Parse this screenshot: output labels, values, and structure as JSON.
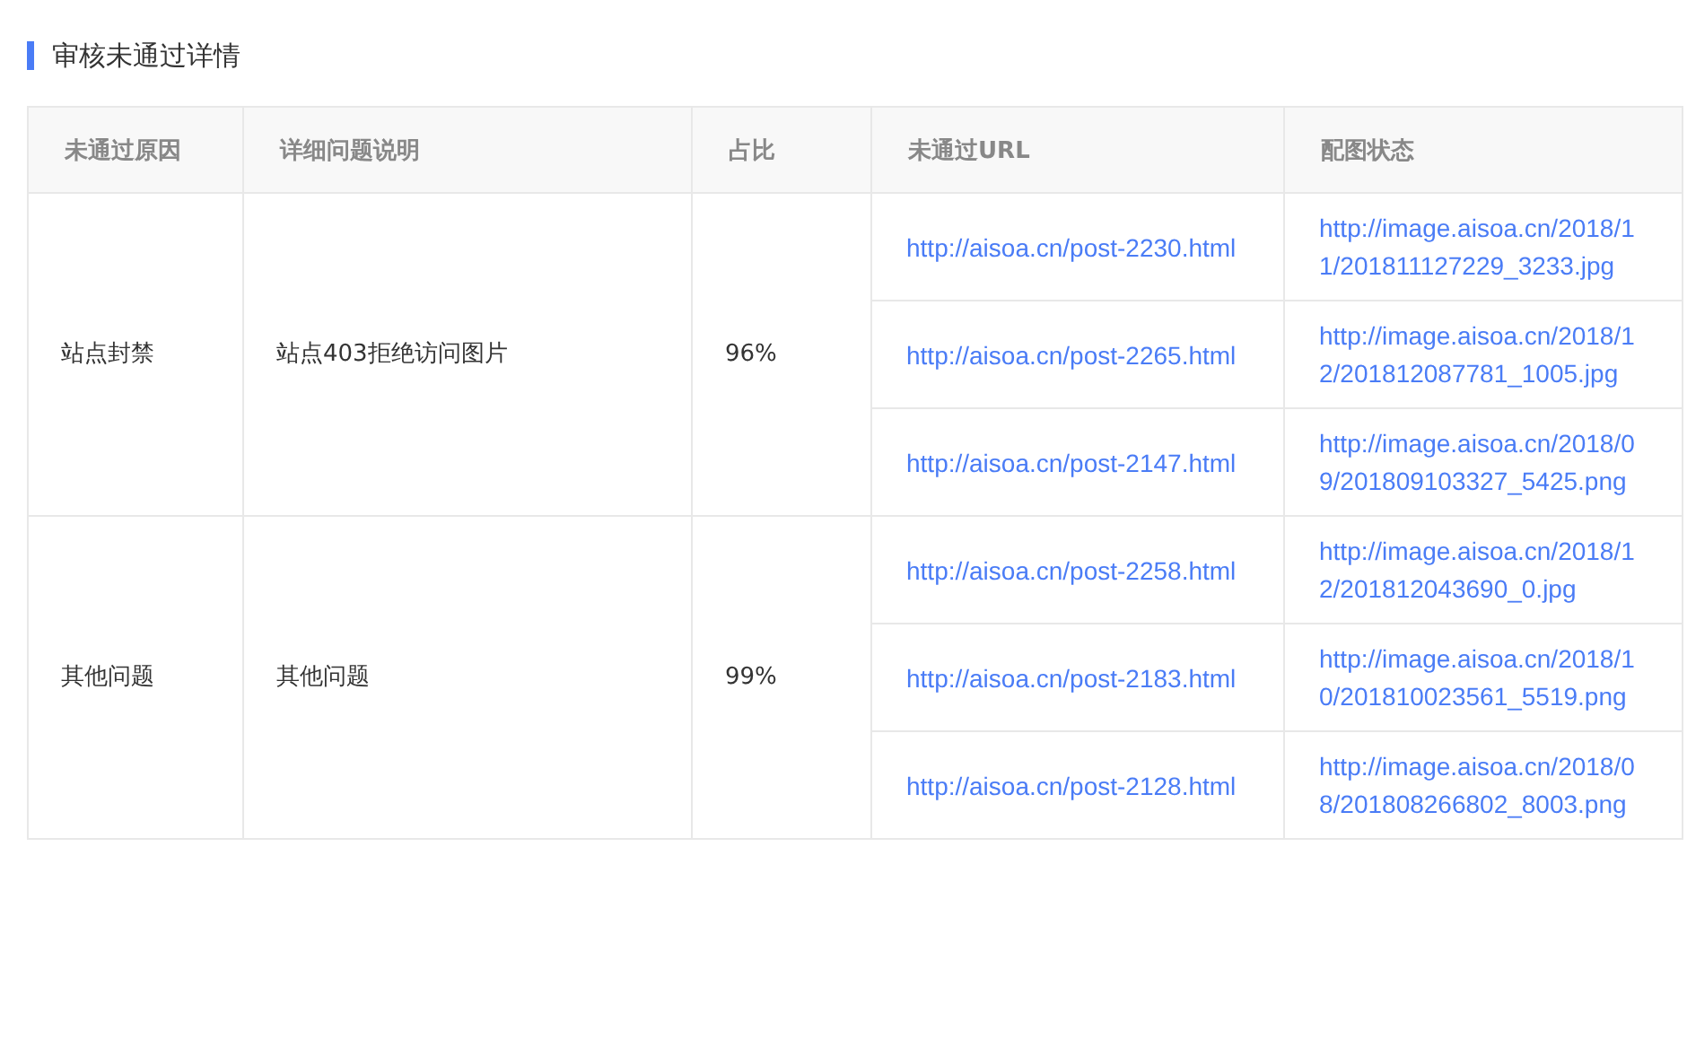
{
  "section_title": "审核未通过详情",
  "table": {
    "columns": [
      "未通过原因",
      "详细问题说明",
      "占比",
      "未通过URL",
      "配图状态"
    ],
    "groups": [
      {
        "reason": "站点封禁",
        "description": "站点403拒绝访问图片",
        "share": "96%",
        "rows": [
          {
            "url": "http://aisoa.cn/post-2230.html",
            "image": "http://image.aisoa.cn/2018/11/201811127229_3233.jpg"
          },
          {
            "url": "http://aisoa.cn/post-2265.html",
            "image": "http://image.aisoa.cn/2018/12/201812087781_1005.jpg"
          },
          {
            "url": "http://aisoa.cn/post-2147.html",
            "image": "http://image.aisoa.cn/2018/09/201809103327_5425.png"
          }
        ]
      },
      {
        "reason": "其他问题",
        "description": "其他问题",
        "share": "99%",
        "rows": [
          {
            "url": "http://aisoa.cn/post-2258.html",
            "image": "http://image.aisoa.cn/2018/12/201812043690_0.jpg"
          },
          {
            "url": "http://aisoa.cn/post-2183.html",
            "image": "http://image.aisoa.cn/2018/10/201810023561_5519.png"
          },
          {
            "url": "http://aisoa.cn/post-2128.html",
            "image": "http://image.aisoa.cn/2018/08/201808266802_8003.png"
          }
        ]
      }
    ]
  }
}
